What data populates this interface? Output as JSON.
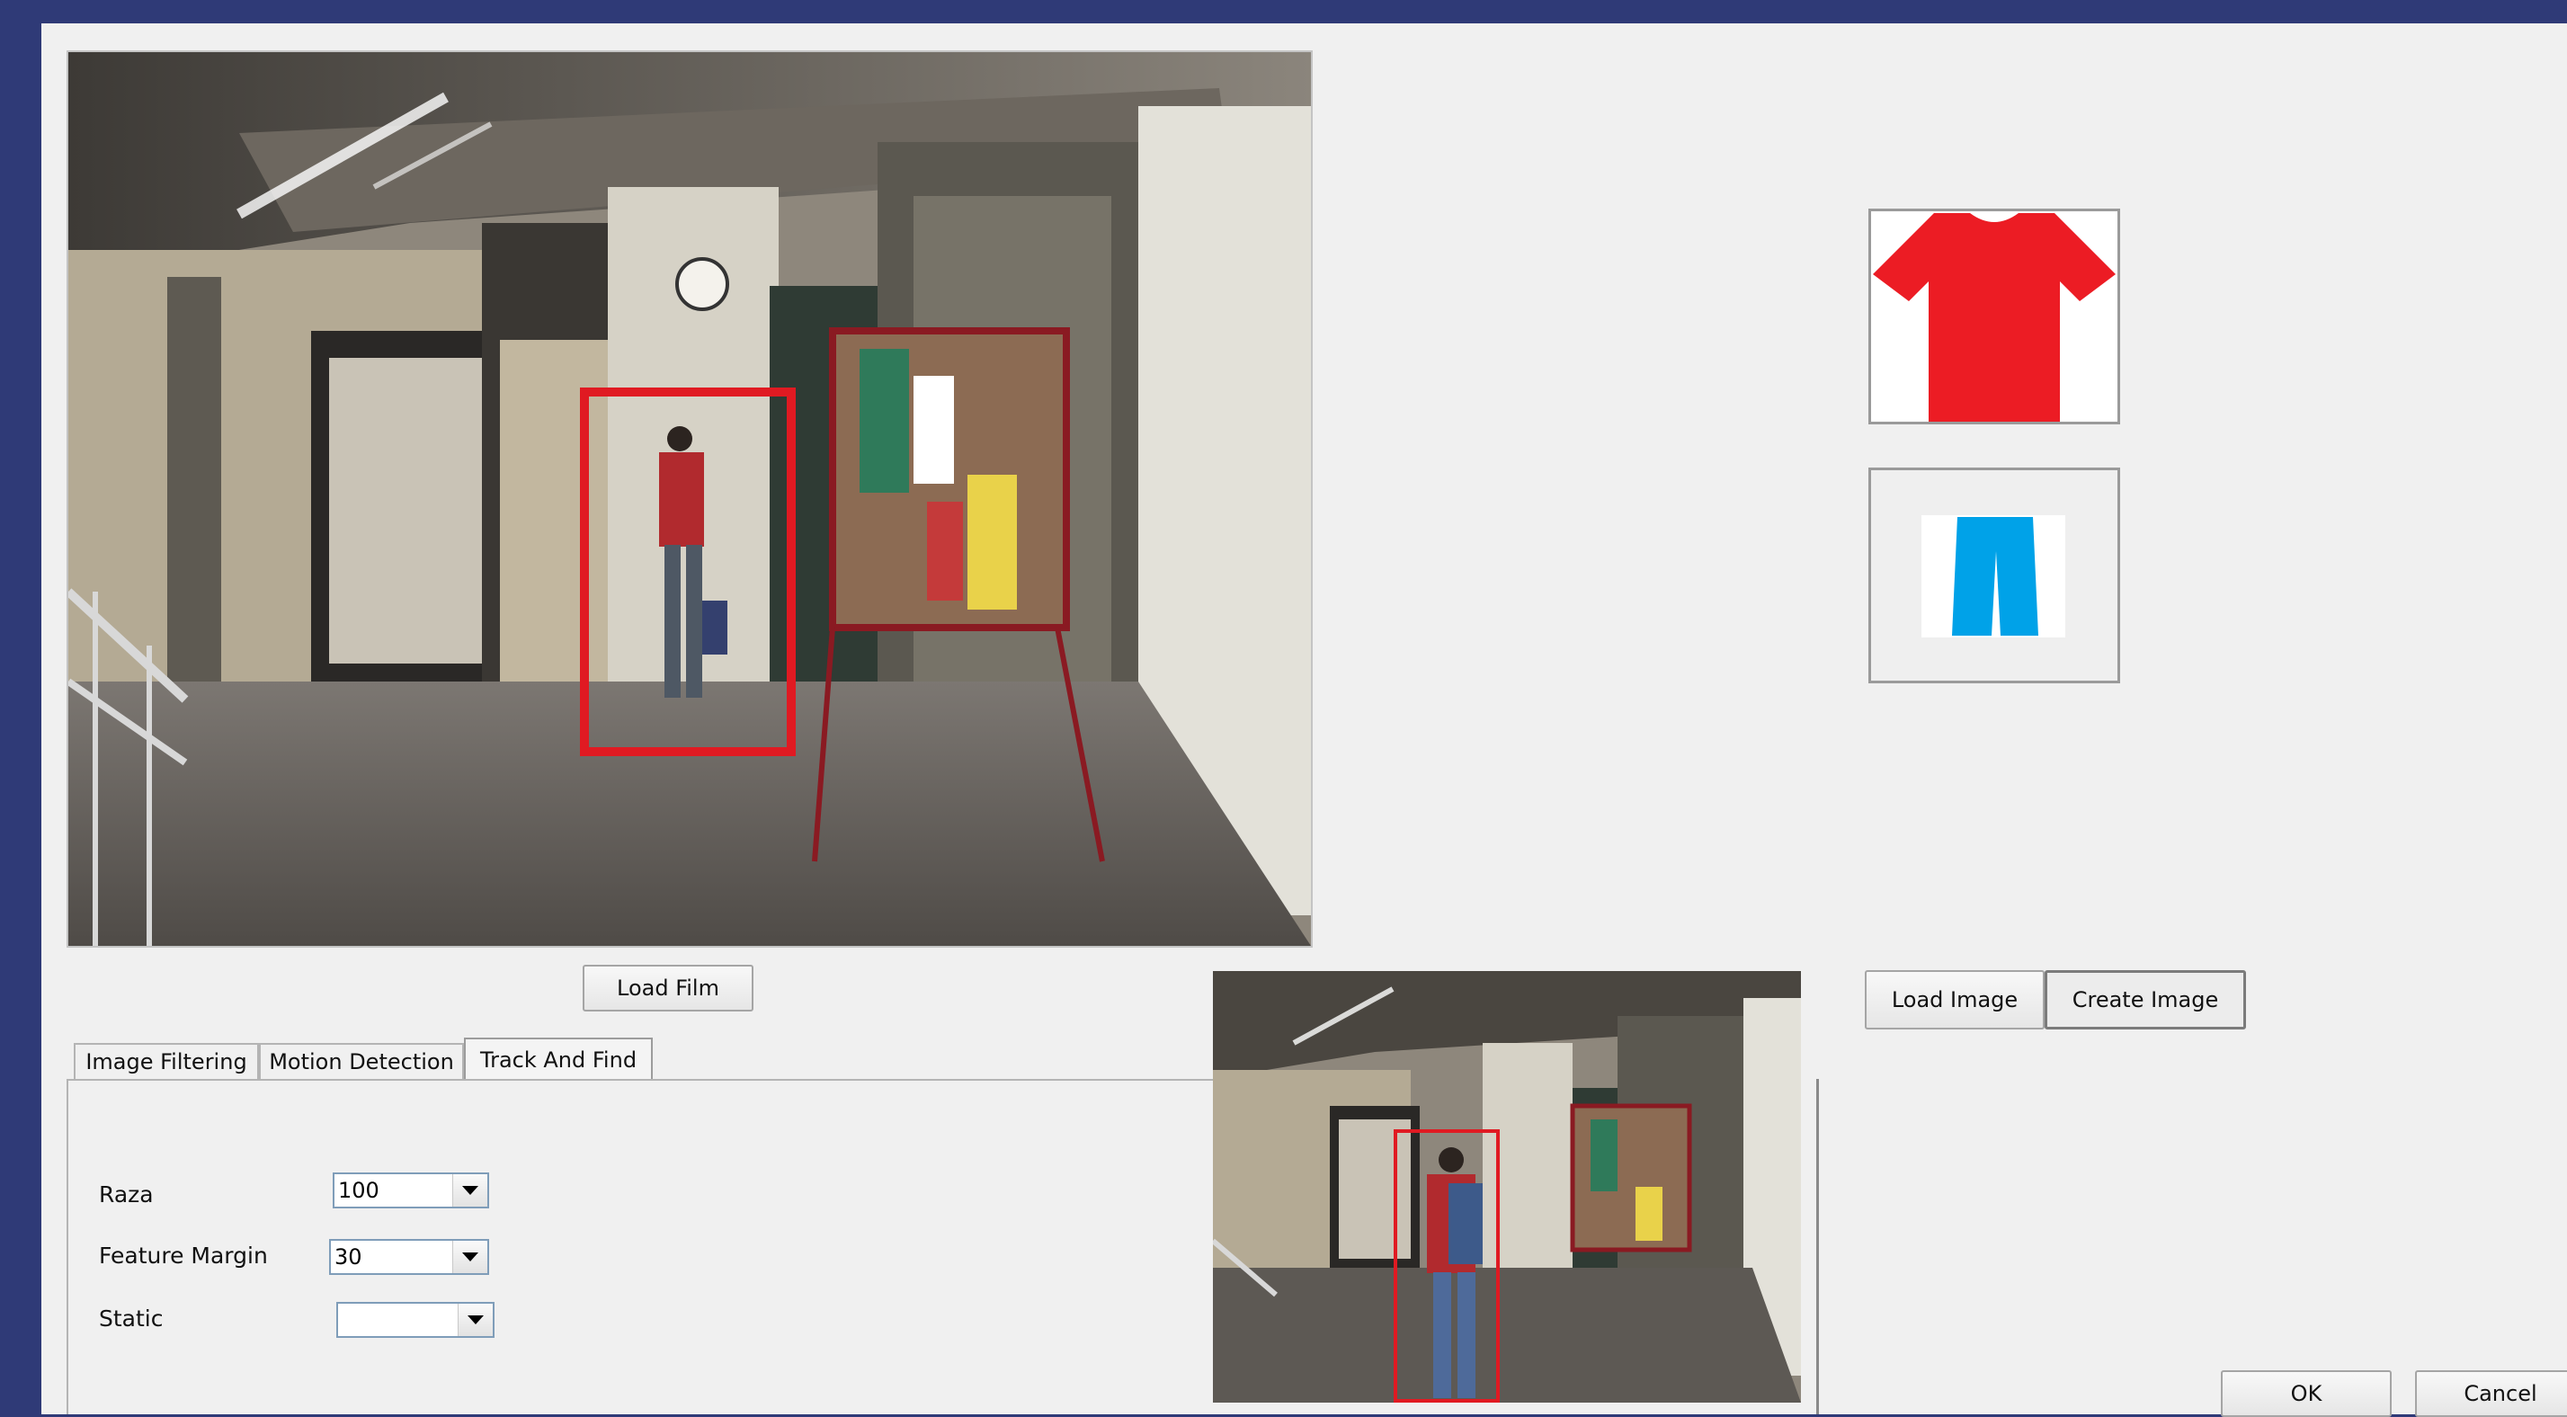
{
  "buttons": {
    "load_film": "Load Film",
    "load_image": "Load Image",
    "create_image": "Create Image",
    "ok": "OK",
    "cancel": "Cancel"
  },
  "tabs": [
    {
      "label": "Image Filtering",
      "active": false
    },
    {
      "label": "Motion Detection",
      "active": false
    },
    {
      "label": "Track And Find",
      "active": true
    }
  ],
  "track_and_find": {
    "raza": {
      "label": "Raza",
      "value": "100"
    },
    "feature_margin": {
      "label": "Feature Margin",
      "value": "30"
    },
    "static": {
      "label": "Static",
      "value": ""
    }
  },
  "garments": {
    "top": {
      "icon": "red-tshirt-icon",
      "color": "#ec1c24"
    },
    "bottom": {
      "icon": "blue-trousers-icon",
      "color": "#00a2e8"
    }
  },
  "colors": {
    "window_frame": "#2f3a77",
    "dialog_bg": "#f0f0f0",
    "tracking_box": "#e01a22"
  }
}
